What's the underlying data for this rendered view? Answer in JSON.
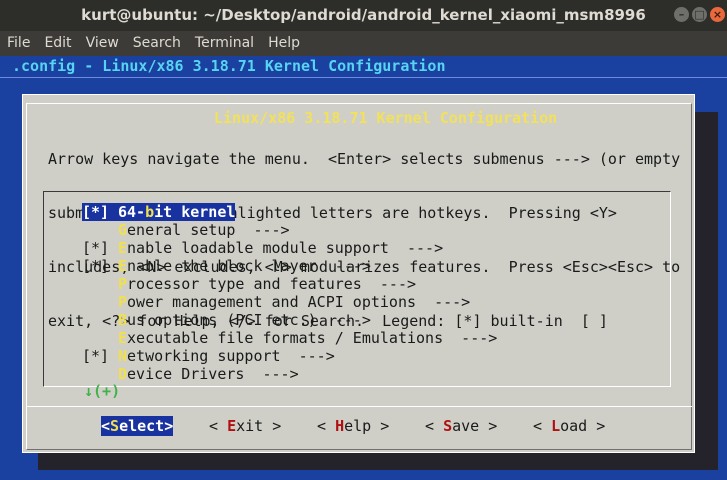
{
  "window": {
    "title": "kurt@ubuntu: ~/Desktop/android/android_kernel_xiaomi_msm8996",
    "buttons": {
      "minimize": "–",
      "maximize": "□",
      "close": "×"
    }
  },
  "menubar": [
    "File",
    "Edit",
    "View",
    "Search",
    "Terminal",
    "Help"
  ],
  "terminal": {
    "backtitle": ".config - Linux/x86 3.18.71 Kernel Configuration",
    "dialog": {
      "title": "Linux/x86 3.18.71 Kernel Configuration",
      "help_lines": [
        "Arrow keys navigate the menu.  <Enter> selects submenus ---> (or empty",
        "submenus ----).  Highlighted letters are hotkeys.  Pressing <Y>",
        "includes, <N> excludes, <M> modularizes features.  Press <Esc><Esc> to",
        "exit, <?> for Help, </> for Search.  Legend: [*] built-in  [ ]"
      ],
      "entries": [
        {
          "mark": "[*]",
          "pre": "64-",
          "hotkey": "b",
          "post": "it kernel",
          "selected": true
        },
        {
          "mark": "",
          "pre": "",
          "hotkey": "G",
          "post": "eneral setup  --->",
          "selected": false
        },
        {
          "mark": "[*]",
          "pre": "",
          "hotkey": "E",
          "post": "nable loadable module support  --->",
          "selected": false
        },
        {
          "mark": "[*]",
          "pre": "",
          "hotkey": "E",
          "post": "nable the block layer  --->",
          "selected": false
        },
        {
          "mark": "",
          "pre": "",
          "hotkey": "P",
          "post": "rocessor type and features  --->",
          "selected": false
        },
        {
          "mark": "",
          "pre": "",
          "hotkey": "P",
          "post": "ower management and ACPI options  --->",
          "selected": false
        },
        {
          "mark": "",
          "pre": "",
          "hotkey": "B",
          "post": "us options (PCI etc.)  --->",
          "selected": false
        },
        {
          "mark": "",
          "pre": "",
          "hotkey": "E",
          "post": "xecutable file formats / Emulations  --->",
          "selected": false
        },
        {
          "mark": "[*]",
          "pre": "",
          "hotkey": "N",
          "post": "etworking support  --->",
          "selected": false
        },
        {
          "mark": "",
          "pre": "",
          "hotkey": "D",
          "post": "evice Drivers  --->",
          "selected": false
        }
      ],
      "more_indicator": "↓(+)",
      "buttons": [
        {
          "pre": "<",
          "hotkey": "S",
          "post": "elect>",
          "selected": true
        },
        {
          "pre": "< ",
          "hotkey": "E",
          "post": "xit >",
          "selected": false
        },
        {
          "pre": "< ",
          "hotkey": "H",
          "post": "elp >",
          "selected": false
        },
        {
          "pre": "< ",
          "hotkey": "S",
          "post": "ave >",
          "selected": false
        },
        {
          "pre": "< ",
          "hotkey": "L",
          "post": "oad >",
          "selected": false
        }
      ]
    }
  },
  "colors": {
    "terminal_bg": "#1a40a0",
    "dialog_bg": "#cfcfc8",
    "hotkey_menu": "#f0e050",
    "hotkey_button": "#b01010",
    "selection": "#18339f",
    "backtitle": "#56d4f0"
  }
}
